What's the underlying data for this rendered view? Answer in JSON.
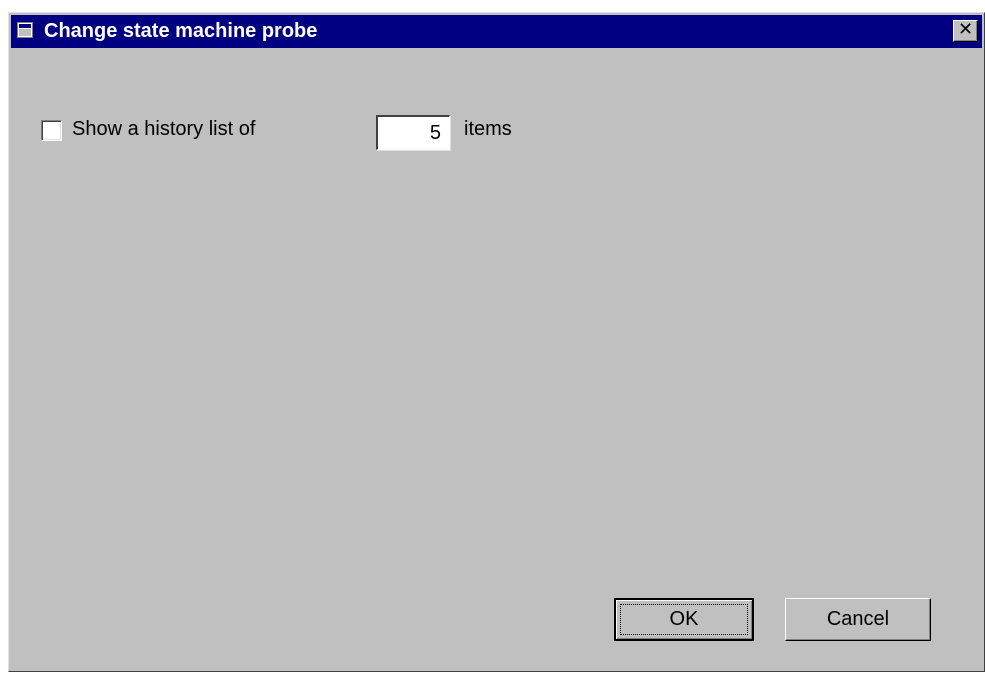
{
  "window": {
    "title": "Change state machine probe",
    "close_glyph": "✕"
  },
  "history": {
    "checkbox_checked": false,
    "label": "Show a history list of",
    "count_value": "5",
    "unit_label": "items"
  },
  "buttons": {
    "ok_label": "OK",
    "cancel_label": "Cancel"
  },
  "colors": {
    "titlebar": "#000080",
    "face": "#c0c0c0"
  },
  "icons": {
    "window": "app-window-icon",
    "close": "close-icon"
  }
}
